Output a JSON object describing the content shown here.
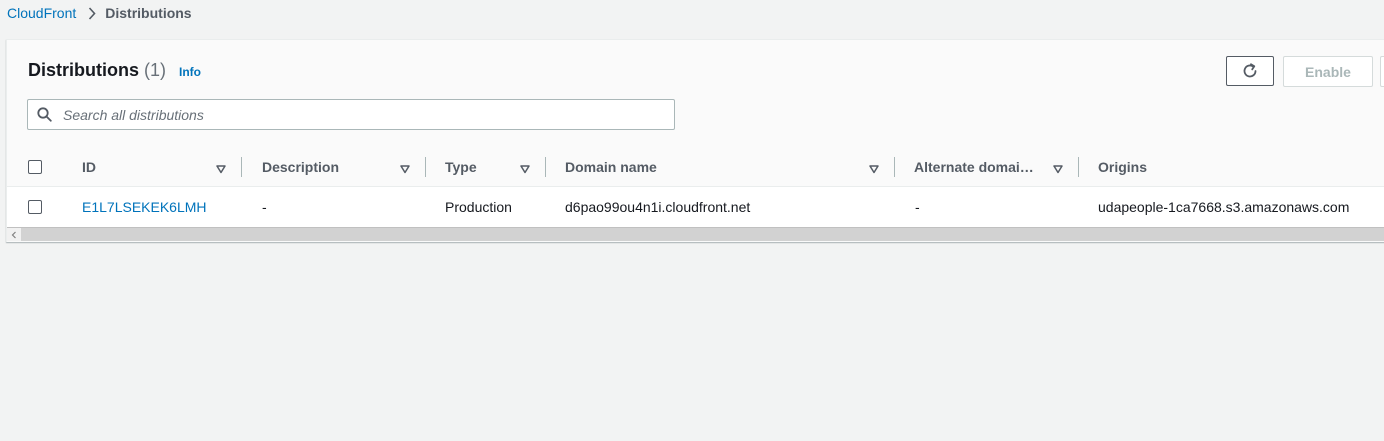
{
  "breadcrumb": {
    "root": "CloudFront",
    "current": "Distributions"
  },
  "header": {
    "title": "Distributions",
    "count": "(1)",
    "info": "Info"
  },
  "actions": {
    "refresh_icon": "refresh-icon",
    "enable_label": "Enable"
  },
  "search": {
    "placeholder": "Search all distributions",
    "value": ""
  },
  "table": {
    "columns": [
      "ID",
      "Description",
      "Type",
      "Domain name",
      "Alternate domai…",
      "Origins"
    ],
    "rows": [
      {
        "id": "E1L7LSEKEK6LMH",
        "description": "-",
        "type": "Production",
        "domain_name": "d6pao99ou4n1i.cloudfront.net",
        "alternate_domain": "-",
        "origins": "udapeople-1ca7668.s3.amazonaws.com"
      }
    ]
  },
  "colors": {
    "link": "#0073bb",
    "background": "#f2f3f3",
    "text": "#16191f",
    "muted": "#545b64"
  }
}
